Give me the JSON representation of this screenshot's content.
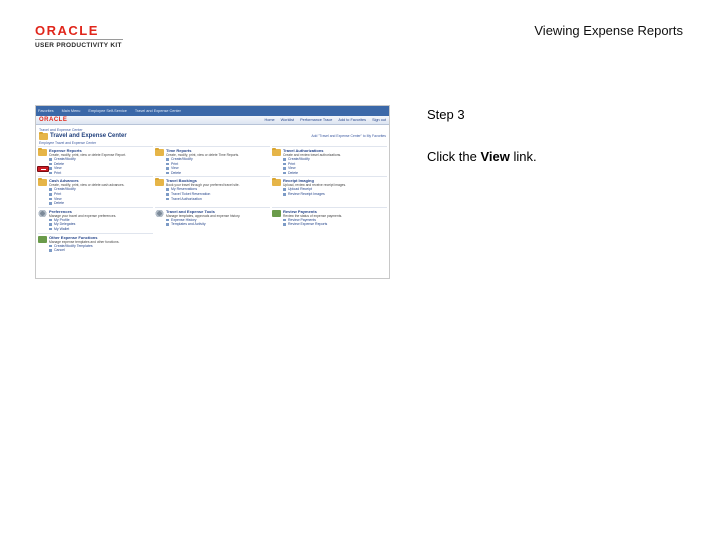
{
  "header": {
    "brand": "ORACLE",
    "kit": "USER PRODUCTIVITY KIT",
    "doc_title": "Viewing Expense Reports"
  },
  "step": {
    "label": "Step 3",
    "instruction_prefix": "Click the ",
    "instruction_bold": "View",
    "instruction_suffix": " link."
  },
  "screenshot": {
    "menu": [
      "Favorites",
      "Main Menu",
      "Employee Self-Service",
      "Travel and Expense Center"
    ],
    "logo": "ORACLE",
    "nav": [
      "Home",
      "Worklist",
      "Performance Trace",
      "Add to Favorites",
      "Sign out"
    ],
    "breadcrumb": "Travel and Expense Center",
    "center_title": "Travel and Expense Center",
    "center_aux": "Add \"Travel and Expense Center\" to My Favorites",
    "customize": "Employee Travel and Expense Center",
    "sections": [
      {
        "icon": "folder-icon",
        "title": "Expense Reports",
        "desc": "Create, modify, print, view or delete Expense Report.",
        "links": [
          "Create/Modify",
          "Delete",
          "View",
          "Print"
        ],
        "highlight": 2
      },
      {
        "icon": "folder-icon",
        "title": "Time Reports",
        "desc": "Create, modify, print, view or delete Time Reports.",
        "links": [
          "Create/Modify",
          "Print",
          "View",
          "Delete"
        ],
        "highlight": -1
      },
      {
        "icon": "folder-icon",
        "title": "Travel Authorizations",
        "desc": "Create and review travel authorizations.",
        "links": [
          "Create/Modify",
          "Print",
          "View",
          "Delete"
        ],
        "highlight": -1
      },
      {
        "icon": "folder-icon",
        "title": "Cash Advances",
        "desc": "Create, modify, print, view or delete cash advances.",
        "links": [
          "Create/Modify",
          "Print",
          "View",
          "Delete"
        ],
        "highlight": -1
      },
      {
        "icon": "folder-icon",
        "title": "Travel Bookings",
        "desc": "Book your travel through your preferred travel site.",
        "links": [
          "My Reservations",
          "Travel Ticket Reservation",
          "Travel Authorization"
        ],
        "highlight": -1
      },
      {
        "icon": "folder-icon",
        "title": "Receipt Imaging",
        "desc": "Upload, review and receive receipt images.",
        "links": [
          "Upload Receipt",
          "Review Receipt Images"
        ],
        "highlight": -1
      },
      {
        "icon": "gear-icon",
        "title": "Preferences",
        "desc": "Manage your travel and expense preferences.",
        "links": [
          "My Profile",
          "My Delegates",
          "My Wallet"
        ],
        "highlight": -1
      },
      {
        "icon": "gear-icon",
        "title": "Travel and Expense Tools",
        "desc": "Manage templates, approvals and expense history.",
        "links": [
          "Expense History",
          "Templates and Activity"
        ],
        "highlight": -1
      },
      {
        "icon": "green-icon",
        "title": "Review Payments",
        "desc": "Review the status of expense payments.",
        "links": [
          "Review Payments",
          "Review Expense Reports"
        ],
        "highlight": -1
      },
      {
        "icon": "green-icon",
        "title": "Other Expense Functions",
        "desc": "Manage expense templates and other functions.",
        "links": [
          "Create/Modify Templates",
          "Cancel"
        ],
        "highlight": -1
      }
    ]
  }
}
